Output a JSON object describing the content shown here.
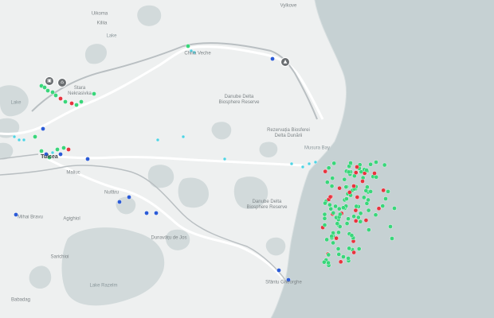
{
  "map": {
    "water_color": "#c6d1d3",
    "land_color": "#eef0f0",
    "lake_color": "#d2dadb",
    "road_color": "#b9bfc2",
    "river_color": "#ffffff"
  },
  "labels": [
    {
      "id": "ukrainian-town",
      "text": "Uikoma"
    },
    {
      "id": "kiliia-top",
      "text": "Kiliia"
    },
    {
      "id": "vylkove",
      "text": "Vylkove"
    },
    {
      "id": "lake-top-left",
      "text": "Lake"
    },
    {
      "id": "lake-left",
      "text": "Lake"
    },
    {
      "id": "stara-nekrasivka",
      "text": "Stara Nekrasivka"
    },
    {
      "id": "chilia-veche",
      "text": "Chilia Veche"
    },
    {
      "id": "reserve-label-1",
      "text": "Danube Delta Biosphere Reserve"
    },
    {
      "id": "reserve-label-2",
      "text": "Rezervația Biosferei Delta Dunării"
    },
    {
      "id": "musura-bay",
      "text": "Musura Bay"
    },
    {
      "id": "tulcea",
      "text": "Tulcea"
    },
    {
      "id": "mahmudia",
      "text": "Maliuc"
    },
    {
      "id": "nufaru",
      "text": "Nufăru"
    },
    {
      "id": "danube-reserve-2",
      "text": "Danube Delta Biosphere Reserve"
    },
    {
      "id": "mihai",
      "text": "Mihai Bravu"
    },
    {
      "id": "agighiol",
      "text": "Agighiol"
    },
    {
      "id": "sarichioi",
      "text": "Sarichioi"
    },
    {
      "id": "babadag",
      "text": "Babadag"
    },
    {
      "id": "lake-razelm",
      "text": "Lake Razelm"
    },
    {
      "id": "dunavatu",
      "text": "Dunavățu de Jos"
    },
    {
      "id": "sfantu-gheorghe",
      "text": "Sfântu Gheorghe"
    }
  ],
  "pois": [
    {
      "id": "poi-stara-1",
      "icon": "camera-icon",
      "glyph": "▣"
    },
    {
      "id": "poi-stara-2",
      "icon": "shop-icon",
      "glyph": "⌂"
    },
    {
      "id": "poi-sulina",
      "icon": "lighthouse-icon",
      "glyph": "▲"
    }
  ],
  "markers": {
    "green_color": "#39d67a",
    "red_color": "#e8333f",
    "blue_color": "#2b5bd7",
    "cyan_color": "#4fd3e3"
  }
}
